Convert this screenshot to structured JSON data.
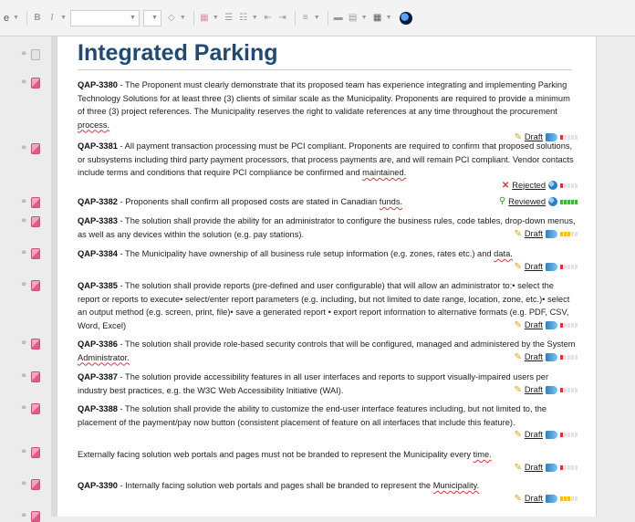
{
  "toolbar": {
    "cut_off_text": "e",
    "bold_label": "B",
    "italic_label": "I"
  },
  "doc": {
    "title": "Integrated Parking"
  },
  "requirements": [
    {
      "code": "QAP-3380",
      "pre": " - The Proponent must clearly demonstrate that its proposed team has experience integrating and implementing Parking Technology Solutions for at least three (3) clients of similar scale as the Municipality. Proponents are required to provide a minimum of three (3) project references. The Municipality reserves the right to validate references at any time throughout the procurement ",
      "wavy": "process.",
      "status": "Draft",
      "status_icon": "pencil-icon",
      "level": "red"
    },
    {
      "code": "QAP-3381",
      "pre": " - All payment transaction processing must be PCI compliant.  Proponents are required to confirm that proposed solutions, or subsystems including third party payment processors, that process payments are, and will remain PCI compliant. Vendor contacts include terms and conditions that require PCI compliance be confirmed and ",
      "wavy": "maintained.",
      "status": "Rejected",
      "status_icon": "x-icon",
      "level": "red"
    },
    {
      "code": "QAP-3382",
      "pre": " - Proponents shall confirm all proposed costs are stated in Canadian ",
      "wavy": "funds.",
      "status": "Reviewed",
      "status_icon": "review-icon",
      "level": "green"
    },
    {
      "code": "QAP-3383",
      "pre": " - The solution shall provide the ability for an administrator to configure the business rules, code tables, drop-down menus, as well as any devices within the solution (e.g. pay stations).",
      "wavy": "",
      "status": "Draft",
      "status_icon": "pencil-icon",
      "level": "yellow"
    },
    {
      "code": "QAP-3384",
      "pre": " - The Municipality have ownership of all business rule setup information (e.g. zones, rates etc.) and ",
      "wavy": "data.",
      "status": "Draft",
      "status_icon": "pencil-icon",
      "level": "red"
    },
    {
      "code": "QAP-3385",
      "pre": " - The solution shall provide reports (pre-defined and user configurable) that will allow an administrator to:• select the report or reports to execute• select/enter report parameters (e.g. including, but not limited to date range, location, zone, etc.)• select an output method (e.g. screen, print, file)• save a generated report • export report information to alternative formats (e.g. PDF, CSV, Word, Excel)",
      "wavy": "",
      "status": "Draft",
      "status_icon": "pencil-icon",
      "level": "red"
    },
    {
      "code": "QAP-3386",
      "pre": " - The solution shall provide role-based security controls that will be configured, managed and administered by the System ",
      "wavy": "Administrator.",
      "status": "Draft",
      "status_icon": "pencil-icon",
      "level": "red"
    },
    {
      "code": "QAP-3387",
      "pre": " - The solution provide accessibility features in all user interfaces and reports to support visually-impaired users per industry best practices, e.g. the W3C Web Accessibility Initiative (WAI).",
      "wavy": "",
      "status": "Draft",
      "status_icon": "pencil-icon",
      "level": "red"
    },
    {
      "code": "QAP-3388",
      "pre": " - The solution shall provide the ability to customize the end-user interface features including, but not limited to, the placement of the payment/pay now button (consistent placement of feature on all interfaces that include this feature).",
      "wavy": "",
      "status": "Draft",
      "status_icon": "pencil-icon",
      "level": "red"
    },
    {
      "code": "",
      "pre": "Externally facing solution web portals and pages must not be branded to represent the Municipality every ",
      "wavy": "time.",
      "status": "Draft",
      "status_icon": "pencil-icon",
      "level": "red"
    },
    {
      "code": "QAP-3390",
      "pre": " - Internally facing solution web portals and pages shall be branded to represent the ",
      "wavy": "Municipality.",
      "status": "Draft",
      "status_icon": "pencil-icon",
      "level": "yellow"
    }
  ],
  "colors": {
    "title": "#1e4a74",
    "red_level": "#e0303a",
    "yellow_level": "#f0c020",
    "green_level": "#42b73a"
  }
}
